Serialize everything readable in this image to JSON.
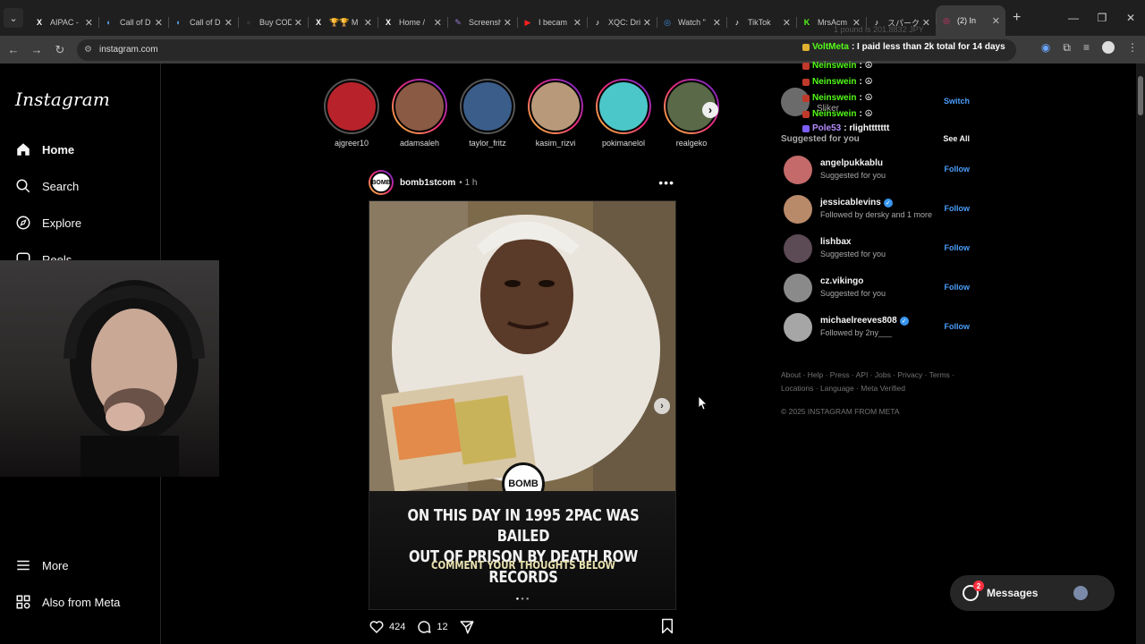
{
  "browser": {
    "tabs": [
      {
        "title": "AIPAC - ",
        "icon": "x-icon",
        "fav": "X",
        "color": "#ffffff"
      },
      {
        "title": "Call of D",
        "icon": "steam-icon",
        "fav": "◐",
        "color": "#5aa0e6"
      },
      {
        "title": "Call of D",
        "icon": "steam-icon",
        "fav": "◐",
        "color": "#5aa0e6"
      },
      {
        "title": "Buy COD",
        "icon": "github-icon",
        "fav": "●",
        "color": "#333333"
      },
      {
        "title": "🏆🏆 M",
        "icon": "x-icon",
        "fav": "X",
        "color": "#ffffff"
      },
      {
        "title": "Home / ",
        "icon": "x-icon",
        "fav": "X",
        "color": "#ffffff"
      },
      {
        "title": "Screensh",
        "icon": "pen-icon",
        "fav": "✎",
        "color": "#9b7bd8"
      },
      {
        "title": "I becam",
        "icon": "youtube-icon",
        "fav": "▶",
        "color": "#ff2020"
      },
      {
        "title": "XQC: Dri",
        "icon": "tiktok-icon",
        "fav": "♪",
        "color": "#ffffff"
      },
      {
        "title": "Watch \"",
        "icon": "web-icon",
        "fav": "◎",
        "color": "#3f8de0"
      },
      {
        "title": "TikTok ",
        "icon": "tiktok-icon",
        "fav": "♪",
        "color": "#ffffff"
      },
      {
        "title": "MrsAcm",
        "icon": "kick-icon",
        "fav": "K",
        "color": "#53fc18"
      },
      {
        "title": "スパークグ",
        "icon": "tiktok-icon",
        "fav": "♪",
        "color": "#ffffff"
      },
      {
        "title": "(2) In",
        "icon": "instagram-icon",
        "fav": "◎",
        "color": "#e1306c",
        "active": true
      }
    ],
    "url": "instagram.com"
  },
  "sidebar": {
    "logo": "Instagram",
    "items": [
      {
        "label": "Home",
        "icon": "home-icon"
      },
      {
        "label": "Search",
        "icon": "search-icon"
      },
      {
        "label": "Explore",
        "icon": "compass-icon"
      },
      {
        "label": "Reels",
        "icon": "reels-icon"
      },
      {
        "label": "More",
        "icon": "hamburger-icon"
      },
      {
        "label": "Also from Meta",
        "icon": "meta-icon"
      }
    ]
  },
  "stories": [
    {
      "name": "ajgreer10",
      "seen": true,
      "color": "#b8232b"
    },
    {
      "name": "adamsaleh",
      "seen": false,
      "color": "#8a5a44"
    },
    {
      "name": "taylor_fritz",
      "seen": true,
      "color": "#3b5d8a"
    },
    {
      "name": "kasim_rizvi",
      "seen": false,
      "color": "#b89a7a"
    },
    {
      "name": "pokimanelol",
      "seen": false,
      "color": "#4cc7c9"
    },
    {
      "name": "realgeko",
      "seen": false,
      "color": "#5a6a48"
    }
  ],
  "post": {
    "user": "bomb1stcom",
    "time": "• 1 h",
    "logo_text": "BOMB",
    "headline": "ON THIS DAY IN 1995 2PAC WAS BAILED\nOUT OF PRISON BY DEATH ROW RECORDS",
    "subline": "COMMENT YOUR THOUGHTS BELOW",
    "likes": "424",
    "comments": "12",
    "slide_count": 3,
    "slide_active": 1
  },
  "right": {
    "switch_label": "Switch",
    "me_username": "",
    "me_sub": "Sliker",
    "suggested_title": "Suggested for you",
    "see_all": "See All",
    "follow_label": "Follow",
    "suggestions": [
      {
        "username": "angelpukkablu",
        "verified": false,
        "sub": "Suggested for you",
        "color": "#c46a6a"
      },
      {
        "username": "jessicablevins",
        "verified": true,
        "sub": "Followed by dersky and 1 more",
        "color": "#b98a6a"
      },
      {
        "username": "lishbax",
        "verified": false,
        "sub": "Suggested for you",
        "color": "#5c4a54"
      },
      {
        "username": "cz.vikingo",
        "verified": false,
        "sub": "Suggested for you",
        "color": "#8a8a8a"
      },
      {
        "username": "michaelreeves808",
        "verified": true,
        "sub": "Followed by 2ny___",
        "color": "#a6a6a6"
      }
    ],
    "footer_links": "About · Help · Press · API · Jobs · Privacy · Terms · Locations · Language · Meta Verified",
    "copyright": "© 2025 INSTAGRAM FROM META"
  },
  "chat": {
    "ghost": "1 pound is 201.8832 JPY",
    "lines": [
      {
        "name": "VoltMeta",
        "message": ": I paid less than 2k total for 14 days",
        "color": "#53fc18",
        "badge": "#e0b030"
      },
      {
        "name": "Neinswein",
        "message": ": ☮",
        "color": "#53fc18",
        "badge": "#c0392b"
      },
      {
        "name": "Neinswein",
        "message": ": ☮",
        "color": "#53fc18",
        "badge": "#c0392b"
      },
      {
        "name": "Neinswein",
        "message": ": ☮",
        "color": "#53fc18",
        "badge": "#c0392b"
      },
      {
        "name": "Neinswein",
        "message": ": ☮",
        "color": "#53fc18",
        "badge": "#c0392b"
      },
      {
        "name": "Pole53",
        "message": ": rlighttttttt",
        "color": "#b48cff",
        "badge": "#7d5fff"
      }
    ]
  },
  "messages": {
    "label": "Messages",
    "count": "2"
  }
}
